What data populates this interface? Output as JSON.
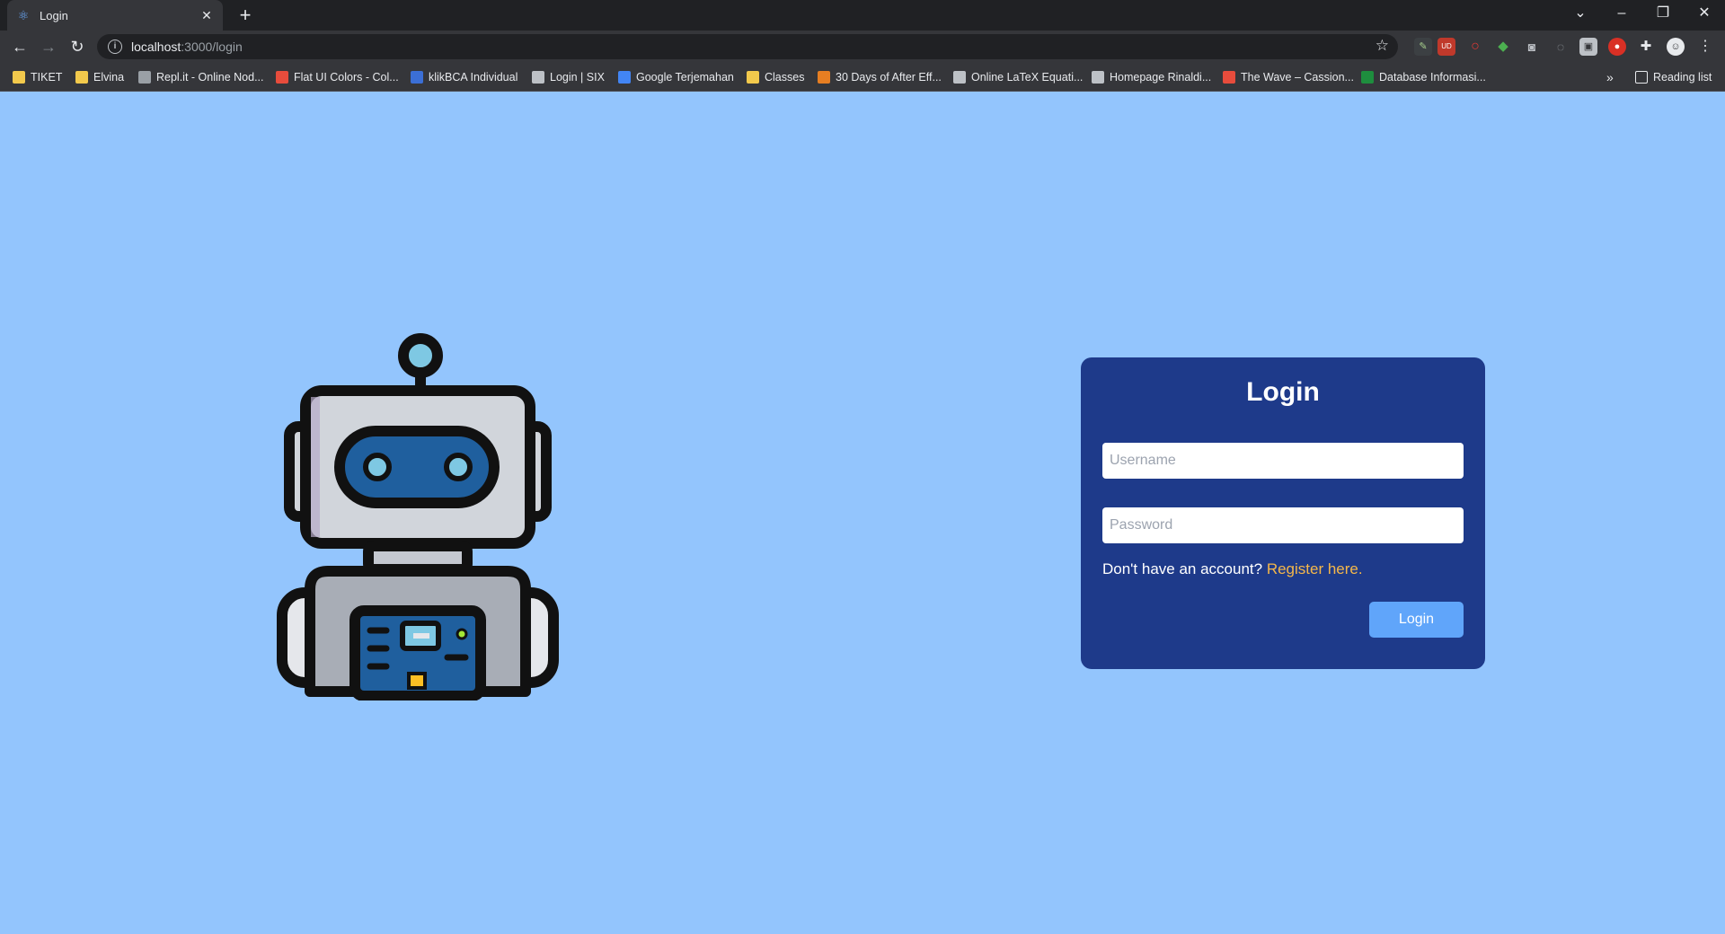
{
  "browser": {
    "tab_title": "Login",
    "url_host": "localhost",
    "url_path": ":3000/login",
    "bookmarks": [
      {
        "label": "TIKET",
        "color": "#f2c94c"
      },
      {
        "label": "Elvina",
        "color": "#f2c94c"
      },
      {
        "label": "Repl.it - Online Nod...",
        "color": "#9aa0a6"
      },
      {
        "label": "Flat UI Colors - Col...",
        "color": "#e74c3c"
      },
      {
        "label": "klikBCA Individual",
        "color": "#3b6fd6"
      },
      {
        "label": "Login | SIX",
        "color": "#bdc1c6"
      },
      {
        "label": "Google Terjemahan",
        "color": "#4285f4"
      },
      {
        "label": "Classes",
        "color": "#f2c94c"
      },
      {
        "label": "30 Days of After Eff...",
        "color": "#e67e22"
      },
      {
        "label": "Online LaTeX Equati...",
        "color": "#bdc1c6"
      },
      {
        "label": "Homepage Rinaldi...",
        "color": "#bdc1c6"
      },
      {
        "label": "The Wave – Cassion...",
        "color": "#e74c3c"
      },
      {
        "label": "Database Informasi...",
        "color": "#1e8e3e"
      }
    ],
    "more_label": "»",
    "reading_list_label": "Reading list"
  },
  "login": {
    "title": "Login",
    "username_placeholder": "Username",
    "password_placeholder": "Password",
    "register_prompt": "Don't have an account? ",
    "register_link": "Register here.",
    "button_label": "Login"
  },
  "colors": {
    "page_background": "#93c5fd",
    "card_background": "#1e3a8a",
    "button": "#60a5fa",
    "link": "#f5b74a"
  }
}
